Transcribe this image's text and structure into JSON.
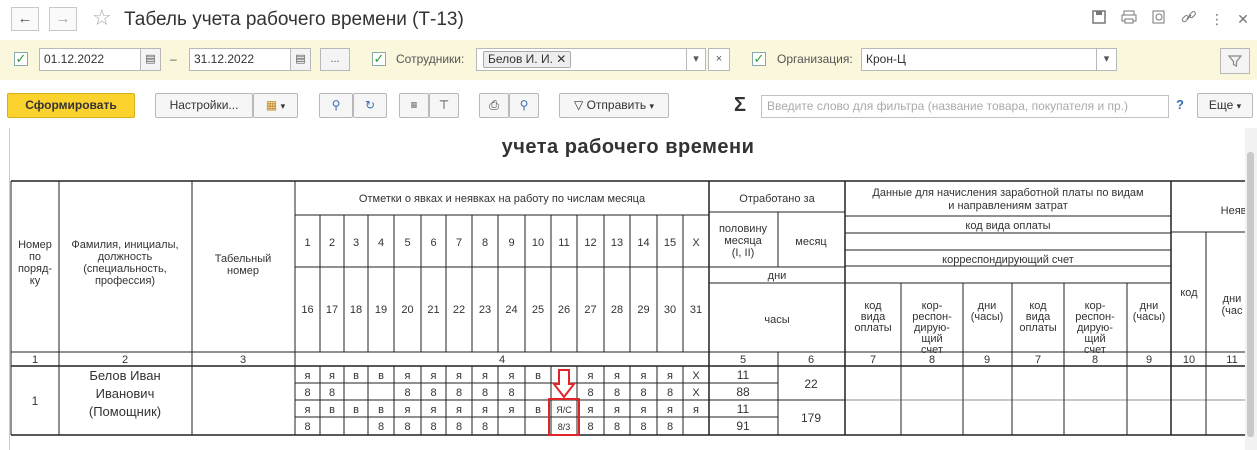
{
  "window": {
    "title": "Табель учета рабочего времени (Т-13)",
    "back_icon": "arrow-left-icon",
    "forward_icon": "arrow-right-icon",
    "favorite_icon": "star-icon"
  },
  "filters": {
    "date_from": "01.12.2022",
    "date_dash": "–",
    "date_to": "31.12.2022",
    "more_label": "...",
    "employees_label": "Сотрудники:",
    "employee_tag": "Белов И. И.",
    "organization_label": "Организация:",
    "organization_value": "Крон-Ц"
  },
  "toolbar": {
    "generate_label": "Сформировать",
    "settings_label": "Настройки...",
    "send_label": "Отправить",
    "sigma": "Σ",
    "search_placeholder": "Введите слово для фильтра (название товара, покупателя и пр.)",
    "help": "?",
    "more_label": "Еще"
  },
  "report": {
    "title": "учета  рабочего времени",
    "h_num": [
      "Номер",
      "по",
      "поряд-",
      "ку"
    ],
    "h_fio": [
      "Фамилия, инициалы,",
      "должность",
      "(специальность,",
      "профессия)"
    ],
    "h_tab": [
      "Табельный",
      "номер"
    ],
    "h_marks": "Отметки о явках и неявках на работу по числам месяца",
    "days_top": [
      "1",
      "2",
      "3",
      "4",
      "5",
      "6",
      "7",
      "8",
      "9",
      "10",
      "11",
      "12",
      "13",
      "14",
      "15",
      "X"
    ],
    "days_bottom": [
      "16",
      "17",
      "18",
      "19",
      "20",
      "21",
      "22",
      "23",
      "24",
      "25",
      "26",
      "27",
      "28",
      "29",
      "30",
      "31"
    ],
    "h_worked": "Отработано за",
    "h_half": [
      "половину",
      "месяца",
      "(I, II)"
    ],
    "h_month": "месяц",
    "h_days": "дни",
    "h_hours": "часы",
    "h_pay": [
      "Данные для начисления заработной платы по видам",
      "и направлениям затрат"
    ],
    "h_paycode": "код вида оплаты",
    "h_corr": "корреспондирующий счет",
    "h_sub": [
      [
        "код",
        "вида",
        "оплаты"
      ],
      [
        "кор-",
        "респон-",
        "дирую-",
        "щий",
        "счет"
      ],
      [
        "дни",
        "(часы)"
      ],
      [
        "код",
        "вида",
        "оплаты"
      ],
      [
        "кор-",
        "респон-",
        "дирую-",
        "щий",
        "счет"
      ],
      [
        "дни",
        "(часы)"
      ]
    ],
    "h_absent": "Неявк",
    "h_code": "код",
    "h_days2": [
      "дни",
      "(час"
    ],
    "colnums": [
      "1",
      "2",
      "3",
      "4",
      "5",
      "6",
      "7",
      "8",
      "9",
      "7",
      "8",
      "9",
      "10",
      "11"
    ],
    "row": {
      "num": "1",
      "fio": [
        "Белов Иван",
        "Иванович",
        "(Помощник)"
      ],
      "marks_r1": [
        "я",
        "я",
        "в",
        "в",
        "я",
        "я",
        "я",
        "я",
        "я",
        "в",
        "",
        "я",
        "я",
        "я",
        "я",
        "X"
      ],
      "hours_r1": [
        "8",
        "8",
        "",
        "",
        "8",
        "8",
        "8",
        "8",
        "8",
        "",
        "",
        "8",
        "8",
        "8",
        "8",
        "X"
      ],
      "marks_r2": [
        "я",
        "в",
        "в",
        "в",
        "я",
        "я",
        "я",
        "я",
        "я",
        "в",
        "Я/С",
        "я",
        "я",
        "я",
        "я",
        "я"
      ],
      "hours_r2": [
        "8",
        "",
        "",
        "8",
        "8",
        "8",
        "8",
        "8",
        "",
        "",
        "8/3",
        "8",
        "8",
        "8",
        "8",
        ""
      ],
      "half1_days": "11",
      "half1_hours": "88",
      "half2_days": "11",
      "half2_hours": "91",
      "month_days": "22",
      "month_hours": "179"
    }
  }
}
